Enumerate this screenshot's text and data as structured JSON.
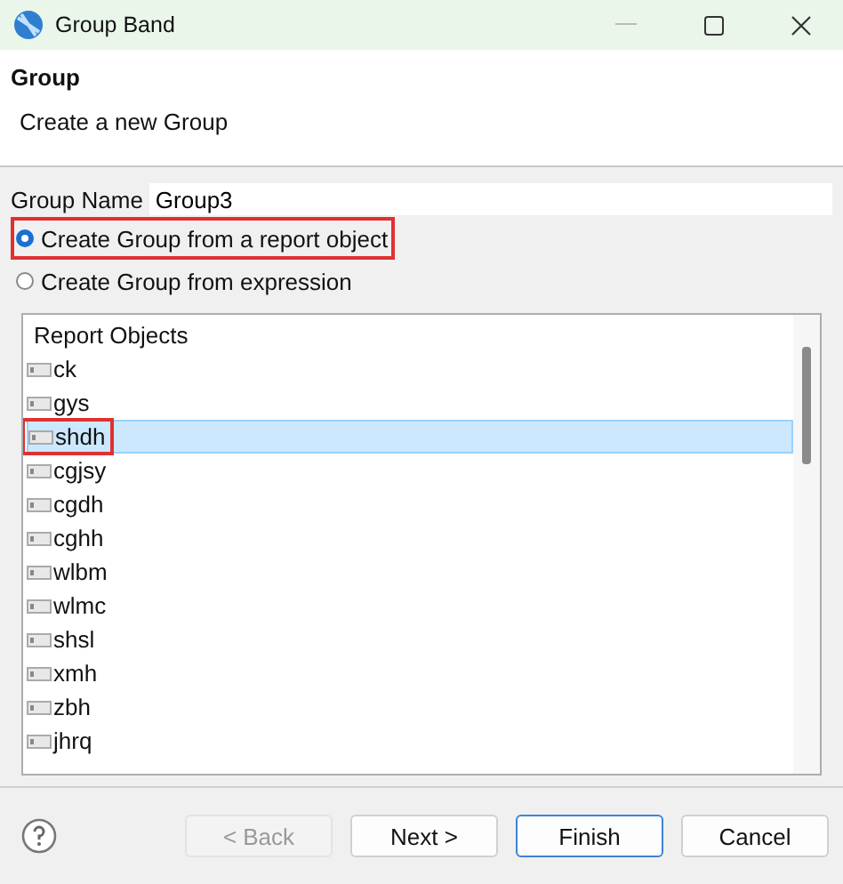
{
  "window": {
    "title": "Group Band"
  },
  "header": {
    "title": "Group",
    "description": "Create a new Group"
  },
  "group_name": {
    "label": "Group Name",
    "value": "Group3"
  },
  "options": [
    {
      "label": "Create Group from a report object",
      "selected": true,
      "highlighted": true
    },
    {
      "label": "Create Group from expression",
      "selected": false,
      "highlighted": false
    }
  ],
  "list": {
    "heading": "Report Objects",
    "items": [
      {
        "label": "ck",
        "selected": false,
        "highlighted": false
      },
      {
        "label": "gys",
        "selected": false,
        "highlighted": false
      },
      {
        "label": "shdh",
        "selected": true,
        "highlighted": true
      },
      {
        "label": "cgjsy",
        "selected": false,
        "highlighted": false
      },
      {
        "label": "cgdh",
        "selected": false,
        "highlighted": false
      },
      {
        "label": "cghh",
        "selected": false,
        "highlighted": false
      },
      {
        "label": "wlbm",
        "selected": false,
        "highlighted": false
      },
      {
        "label": "wlmc",
        "selected": false,
        "highlighted": false
      },
      {
        "label": "shsl",
        "selected": false,
        "highlighted": false
      },
      {
        "label": "xmh",
        "selected": false,
        "highlighted": false
      },
      {
        "label": "zbh",
        "selected": false,
        "highlighted": false
      },
      {
        "label": "jhrq",
        "selected": false,
        "highlighted": false
      }
    ]
  },
  "buttons": [
    {
      "label": "< Back",
      "disabled": true,
      "default": false
    },
    {
      "label": "Next >",
      "disabled": false,
      "default": false
    },
    {
      "label": "Finish",
      "disabled": false,
      "default": true
    },
    {
      "label": "Cancel",
      "disabled": false,
      "default": false
    }
  ]
}
